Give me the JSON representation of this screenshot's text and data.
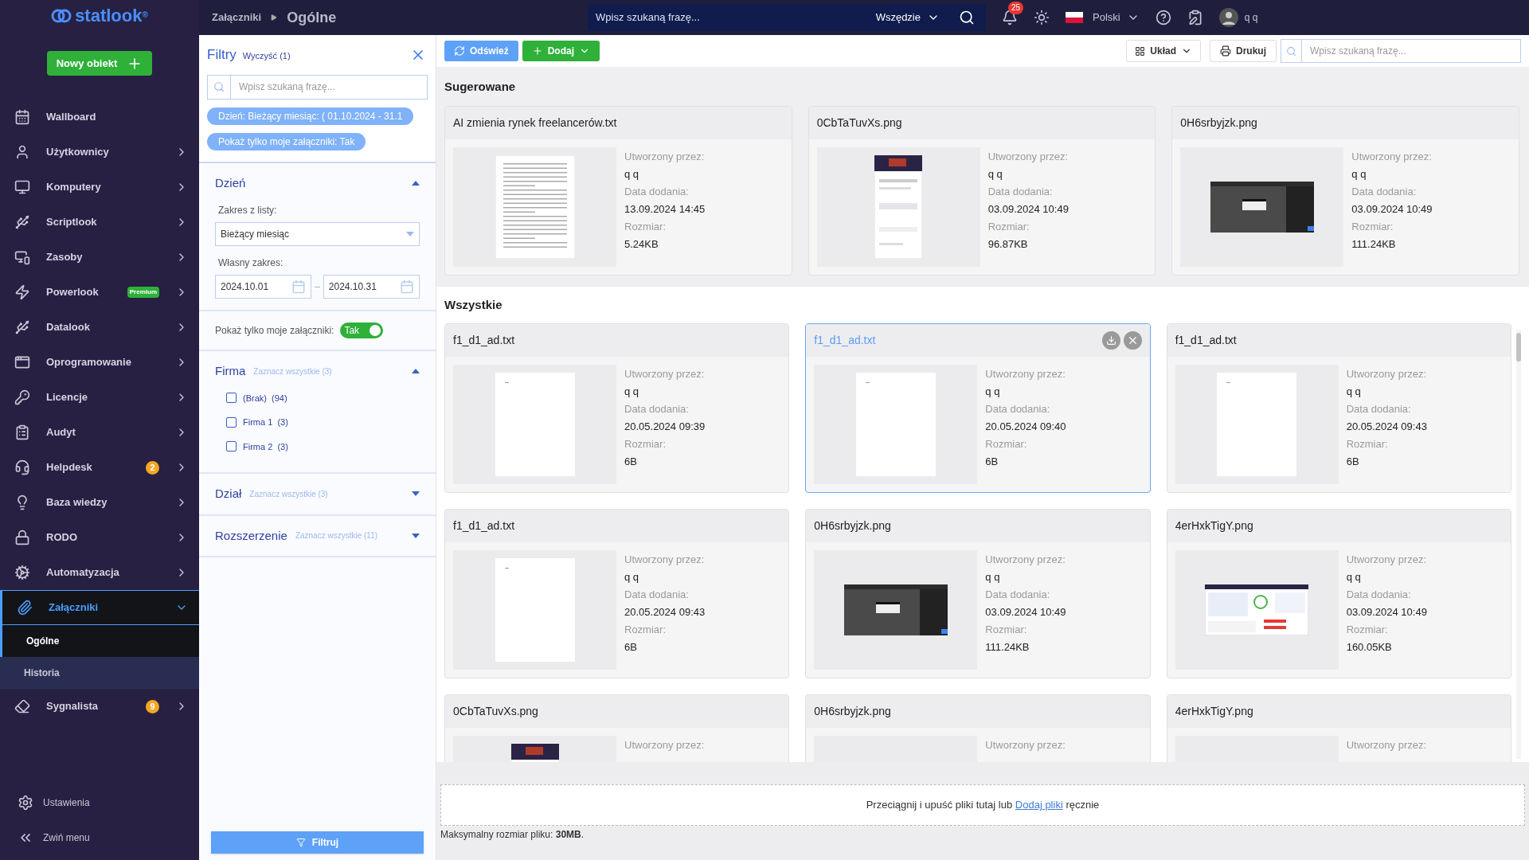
{
  "sidebar": {
    "logo": "statlook",
    "logo_mark": "®",
    "new_button": "Nowy obiekt",
    "items": [
      {
        "label": "Wallboard",
        "chevron": false,
        "expanded": false,
        "selected": false
      },
      {
        "label": "Użytkownicy",
        "chevron": true,
        "expanded": false,
        "selected": false
      },
      {
        "label": "Komputery",
        "chevron": true,
        "expanded": false,
        "selected": false
      },
      {
        "label": "Scriptlook",
        "chevron": true,
        "expanded": false,
        "selected": false
      },
      {
        "label": "Zasoby",
        "chevron": true,
        "expanded": false,
        "selected": false
      },
      {
        "label": "Powerlook",
        "chevron": true,
        "expanded": false,
        "selected": false,
        "tag": "Premium"
      },
      {
        "label": "Datalook",
        "chevron": true,
        "expanded": false,
        "selected": false
      },
      {
        "label": "Oprogramowanie",
        "chevron": true,
        "expanded": false,
        "selected": false
      },
      {
        "label": "Licencje",
        "chevron": true,
        "expanded": false,
        "selected": false
      },
      {
        "label": "Audyt",
        "chevron": true,
        "expanded": false,
        "selected": false
      },
      {
        "label": "Helpdesk",
        "chevron": true,
        "expanded": false,
        "selected": false,
        "badge": "2"
      },
      {
        "label": "Baza wiedzy",
        "chevron": true,
        "expanded": false,
        "selected": false
      },
      {
        "label": "RODO",
        "chevron": true,
        "expanded": false,
        "selected": false
      },
      {
        "label": "Automatyzacja",
        "chevron": true,
        "expanded": false,
        "selected": false
      },
      {
        "label": "Załączniki",
        "chevron": true,
        "expanded": true,
        "selected": true,
        "children": [
          {
            "label": "Ogólne",
            "selected": true
          },
          {
            "label": "Historia",
            "selected": false
          }
        ]
      },
      {
        "label": "Sygnalista",
        "chevron": true,
        "expanded": false,
        "selected": false,
        "badge": "9"
      }
    ],
    "footer": [
      {
        "label": "Ustawienia"
      },
      {
        "label": "Zwiń menu"
      }
    ]
  },
  "topbar": {
    "breadcrumb": [
      "Załączniki",
      "Ogólne"
    ],
    "search": {
      "placeholder": "Wpisz szukaną frazę..."
    },
    "scope": "Wszędzie",
    "notifications": "25",
    "language": "Polski",
    "user": "q q"
  },
  "filters": {
    "title": "Filtry",
    "clear": "Wyczyść (1)",
    "search": {
      "placeholder": "Wpisz szukaną frazę..."
    },
    "chips": [
      "Dzień: Bieżący miesiąc: ( 01.10.2024 - 31.1",
      "Pokaż tylko moje załączniki: Tak"
    ],
    "day": {
      "title": "Dzień",
      "expanded": true,
      "range_label": "Zakres z listy:",
      "range_value": "Bieżący miesiąc",
      "custom_label": "Własny zakres:",
      "from": "2024.10.01",
      "separator": "–",
      "to": "2024.10.31"
    },
    "mine": {
      "label": "Pokaż tylko moje załączniki:",
      "on": true,
      "text": "Tak"
    },
    "sections": [
      {
        "title": "Firma",
        "select_all": "Zaznacz wszystkie (3)",
        "expanded": true,
        "options": [
          {
            "label": "(Brak)",
            "count": "(94)",
            "checked": false
          },
          {
            "label": "Firma 1",
            "count": "(3)",
            "checked": false
          },
          {
            "label": "Firma 2",
            "count": "(3)",
            "checked": false
          }
        ]
      },
      {
        "title": "Dział",
        "select_all": "Zaznacz wszystkie (3)",
        "expanded": false
      },
      {
        "title": "Rozszerzenie",
        "select_all": "Zaznacz wszystkie (11)",
        "expanded": false
      }
    ],
    "apply": "Filtruj"
  },
  "toolbar": {
    "refresh": "Odśwież",
    "add": "Dodaj",
    "layout": "Układ",
    "print": "Drukuj",
    "search": {
      "placeholder": "Wpisz szukaną frazę..."
    }
  },
  "suggested": {
    "title": "Sugerowane",
    "cards": [
      {
        "name": "AI zmienia rynek freelancerów.txt",
        "kind": "text",
        "selected": false,
        "fields": [
          {
            "label": "Utworzony przez:",
            "value": "q q"
          },
          {
            "label": "Data dodania:",
            "value": "13.09.2024 14:45"
          },
          {
            "label": "Rozmiar:",
            "value": "5.24KB"
          }
        ]
      },
      {
        "name": "0CbTaTuvXs.png",
        "kind": "portrait",
        "selected": false,
        "fields": [
          {
            "label": "Utworzony przez:",
            "value": "q q"
          },
          {
            "label": "Data dodania:",
            "value": "03.09.2024 10:49"
          },
          {
            "label": "Rozmiar:",
            "value": "96.87KB"
          }
        ]
      },
      {
        "name": "0H6srbyjzk.png",
        "kind": "dark",
        "selected": false,
        "fields": [
          {
            "label": "Utworzony przez:",
            "value": "q q"
          },
          {
            "label": "Data dodania:",
            "value": "03.09.2024 10:49"
          },
          {
            "label": "Rozmiar:",
            "value": "111.24KB"
          }
        ]
      }
    ]
  },
  "all": {
    "title": "Wszystkie",
    "cards": [
      {
        "name": "f1_d1_ad.txt",
        "kind": "blank",
        "selected": false,
        "fields": [
          {
            "label": "Utworzony przez:",
            "value": "q q"
          },
          {
            "label": "Data dodania:",
            "value": "20.05.2024 09:39"
          },
          {
            "label": "Rozmiar:",
            "value": "6B"
          }
        ]
      },
      {
        "name": "f1_d1_ad.txt",
        "kind": "blank",
        "selected": true,
        "fields": [
          {
            "label": "Utworzony przez:",
            "value": "q q"
          },
          {
            "label": "Data dodania:",
            "value": "20.05.2024 09:40"
          },
          {
            "label": "Rozmiar:",
            "value": "6B"
          }
        ]
      },
      {
        "name": "f1_d1_ad.txt",
        "kind": "blank",
        "selected": false,
        "fields": [
          {
            "label": "Utworzony przez:",
            "value": "q q"
          },
          {
            "label": "Data dodania:",
            "value": "20.05.2024 09:43"
          },
          {
            "label": "Rozmiar:",
            "value": "6B"
          }
        ]
      },
      {
        "name": "f1_d1_ad.txt",
        "kind": "blank",
        "selected": false,
        "fields": [
          {
            "label": "Utworzony przez:",
            "value": "q q"
          },
          {
            "label": "Data dodania:",
            "value": "20.05.2024 09:43"
          },
          {
            "label": "Rozmiar:",
            "value": "6B"
          }
        ]
      },
      {
        "name": "0H6srbyjzk.png",
        "kind": "dark",
        "selected": false,
        "fields": [
          {
            "label": "Utworzony przez:",
            "value": "q q"
          },
          {
            "label": "Data dodania:",
            "value": "03.09.2024 10:49"
          },
          {
            "label": "Rozmiar:",
            "value": "111.24KB"
          }
        ]
      },
      {
        "name": "4erHxkTigY.png",
        "kind": "light",
        "selected": false,
        "fields": [
          {
            "label": "Utworzony przez:",
            "value": "q q"
          },
          {
            "label": "Data dodania:",
            "value": "03.09.2024 10:49"
          },
          {
            "label": "Rozmiar:",
            "value": "160.05KB"
          }
        ]
      },
      {
        "name": "0CbTaTuvXs.png",
        "kind": "portrait",
        "selected": false,
        "fields": [
          {
            "label": "Utworzony przez:"
          }
        ]
      },
      {
        "name": "0H6srbyjzk.png",
        "selected": false,
        "fields": [
          {
            "label": "Utworzony przez:"
          }
        ]
      },
      {
        "name": "4erHxkTigY.png",
        "selected": false,
        "fields": [
          {
            "label": "Utworzony przez:"
          }
        ]
      }
    ]
  },
  "dropzone": {
    "text": "Przeciągnij i upuść pliki tutaj lub ",
    "link": "Dodaj pliki",
    "after": " ręcznie",
    "limit": "Maksymalny rozmiar pliku: **30MB**."
  }
}
